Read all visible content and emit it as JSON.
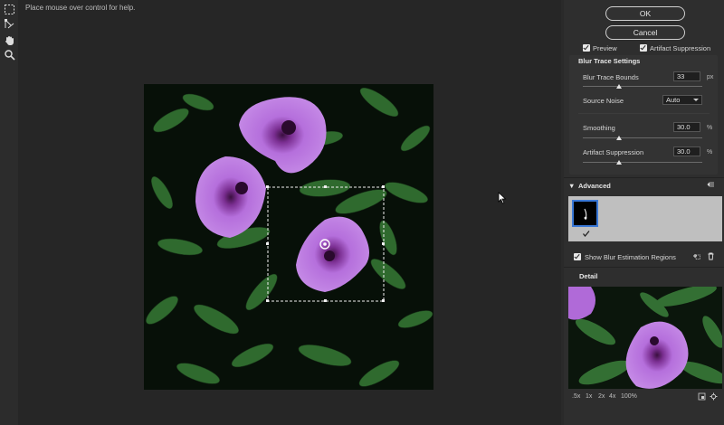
{
  "help_text": "Place mouse over control for help.",
  "tools": [
    {
      "icon": "blur-trace-tool-icon"
    },
    {
      "icon": "blur-direction-tool-icon"
    },
    {
      "icon": "hand-tool-icon"
    },
    {
      "icon": "zoom-tool-icon"
    }
  ],
  "buttons": {
    "ok": "OK",
    "cancel": "Cancel"
  },
  "options": {
    "preview": "Preview",
    "artifact_suppression": "Artifact Suppression"
  },
  "blur_trace": {
    "title": "Blur Trace Settings",
    "bounds_label": "Blur Trace Bounds",
    "bounds_value": "33",
    "bounds_unit": "px",
    "bounds_level": 0.38,
    "noise_label": "Source Noise",
    "noise_value": "Auto",
    "smoothing_label": "Smoothing",
    "smoothing_value": "30.0",
    "smoothing_unit": "%",
    "smoothing_level": 0.3,
    "artifact_label": "Artifact Suppression",
    "artifact_value": "30.0",
    "artifact_unit": "%",
    "artifact_level": 0.3
  },
  "advanced": {
    "title": "Advanced",
    "show_regions": "Show Blur Estimation Regions"
  },
  "detail": {
    "title": "Detail"
  },
  "zoom_levels": [
    ".5x",
    "1x",
    "2x",
    "4x",
    "100%"
  ],
  "colors": {
    "bg": "#2a2a2a",
    "panel": "#2e2e2e",
    "accent": "#3a78d6",
    "flower": "#b06ad8"
  }
}
